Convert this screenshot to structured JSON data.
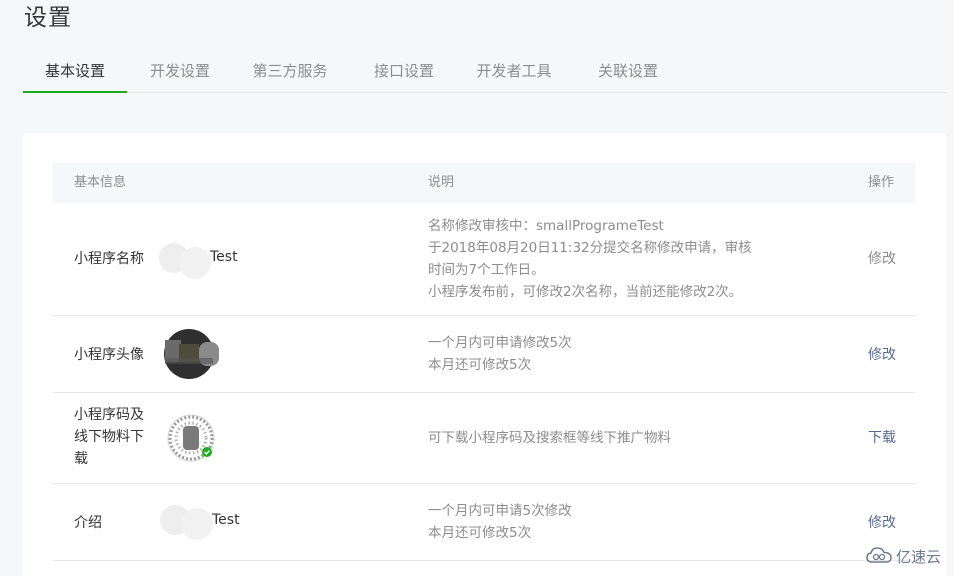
{
  "page": {
    "title": "设置"
  },
  "tabs": [
    {
      "label": "基本设置",
      "active": true
    },
    {
      "label": "开发设置",
      "active": false
    },
    {
      "label": "第三方服务",
      "active": false
    },
    {
      "label": "接口设置",
      "active": false
    },
    {
      "label": "开发者工具",
      "active": false
    },
    {
      "label": "关联设置",
      "active": false
    }
  ],
  "table": {
    "headers": {
      "info": "基本信息",
      "desc": "说明",
      "op": "操作"
    },
    "rows": [
      {
        "label": "小程序名称",
        "value": "Test",
        "desc": [
          "名称修改审核中：smallProgrameTest",
          "于2018年08月20日11:32分提交名称修改申请，审核",
          "时间为7个工作日。",
          "小程序发布前，可修改2次名称，当前还能修改2次。"
        ],
        "op": "修改",
        "op_state": "disabled"
      },
      {
        "label": "小程序头像",
        "desc": [
          "一个月内可申请修改5次",
          "本月还可修改5次"
        ],
        "op": "修改",
        "op_state": "link"
      },
      {
        "label": "小程序码及线下物料下载",
        "desc": [
          "可下载小程序码及搜索框等线下推广物料"
        ],
        "op": "下载",
        "op_state": "link"
      },
      {
        "label": "介绍",
        "value": "Test",
        "desc": [
          "一个月内可申请5次修改",
          "本月还可修改5次"
        ],
        "op": "修改",
        "op_state": "link"
      }
    ]
  },
  "watermark": {
    "text": "亿速云",
    "icon": "cloud-logo-icon"
  },
  "colors": {
    "accent_green": "#1aad19",
    "link_blue": "#576b95",
    "muted_text": "#8d8d8d",
    "page_bg": "#f6f7f9"
  }
}
